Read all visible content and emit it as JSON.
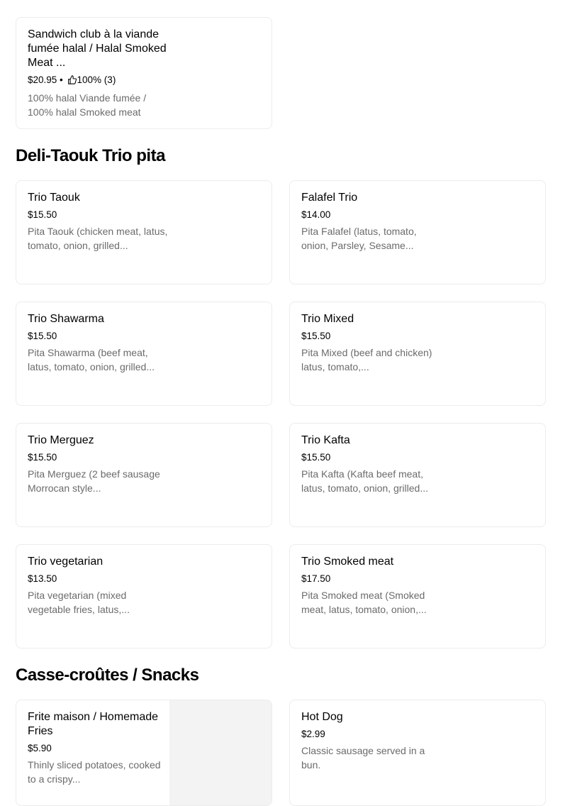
{
  "sections": [
    {
      "items": [
        {
          "name": "Sandwich club à la viande fumée halal / Halal Smoked Meat ...",
          "price": "$20.95",
          "rating": "100% (3)",
          "description": "100% halal Viande fumée / 100% halal Smoked meat"
        }
      ]
    },
    {
      "title": "Deli-Taouk Trio pita",
      "items": [
        {
          "name": "Trio Taouk",
          "price": "$15.50",
          "description": "Pita Taouk (chicken meat, latus, tomato, onion, grilled..."
        },
        {
          "name": "Falafel Trio",
          "price": "$14.00",
          "description": "Pita Falafel (latus, tomato, onion, Parsley, Sesame..."
        },
        {
          "name": "Trio Shawarma",
          "price": "$15.50",
          "description": "Pita Shawarma (beef meat, latus, tomato, onion, grilled..."
        },
        {
          "name": "Trio Mixed",
          "price": "$15.50",
          "description": "Pita Mixed (beef and chicken) latus, tomato,..."
        },
        {
          "name": "Trio Merguez",
          "price": "$15.50",
          "description": "Pita Merguez (2 beef sausage Morrocan style..."
        },
        {
          "name": "Trio Kafta",
          "price": "$15.50",
          "description": "Pita Kafta (Kafta beef meat, latus, tomato, onion, grilled..."
        },
        {
          "name": "Trio vegetarian",
          "price": "$13.50",
          "description": "Pita vegetarian (mixed vegetable fries, latus,..."
        },
        {
          "name": "Trio Smoked meat",
          "price": "$17.50",
          "description": "Pita Smoked meat (Smoked meat, latus, tomato, onion,..."
        }
      ]
    },
    {
      "title": "Casse-croûtes / Snacks",
      "items": [
        {
          "name": "Frite maison / Homemade Fries",
          "price": "$5.90",
          "description": "Thinly sliced potatoes, cooked to a crispy..."
        },
        {
          "name": "Hot Dog",
          "price": "$2.99",
          "description": "Classic sausage served in a bun."
        }
      ]
    }
  ]
}
